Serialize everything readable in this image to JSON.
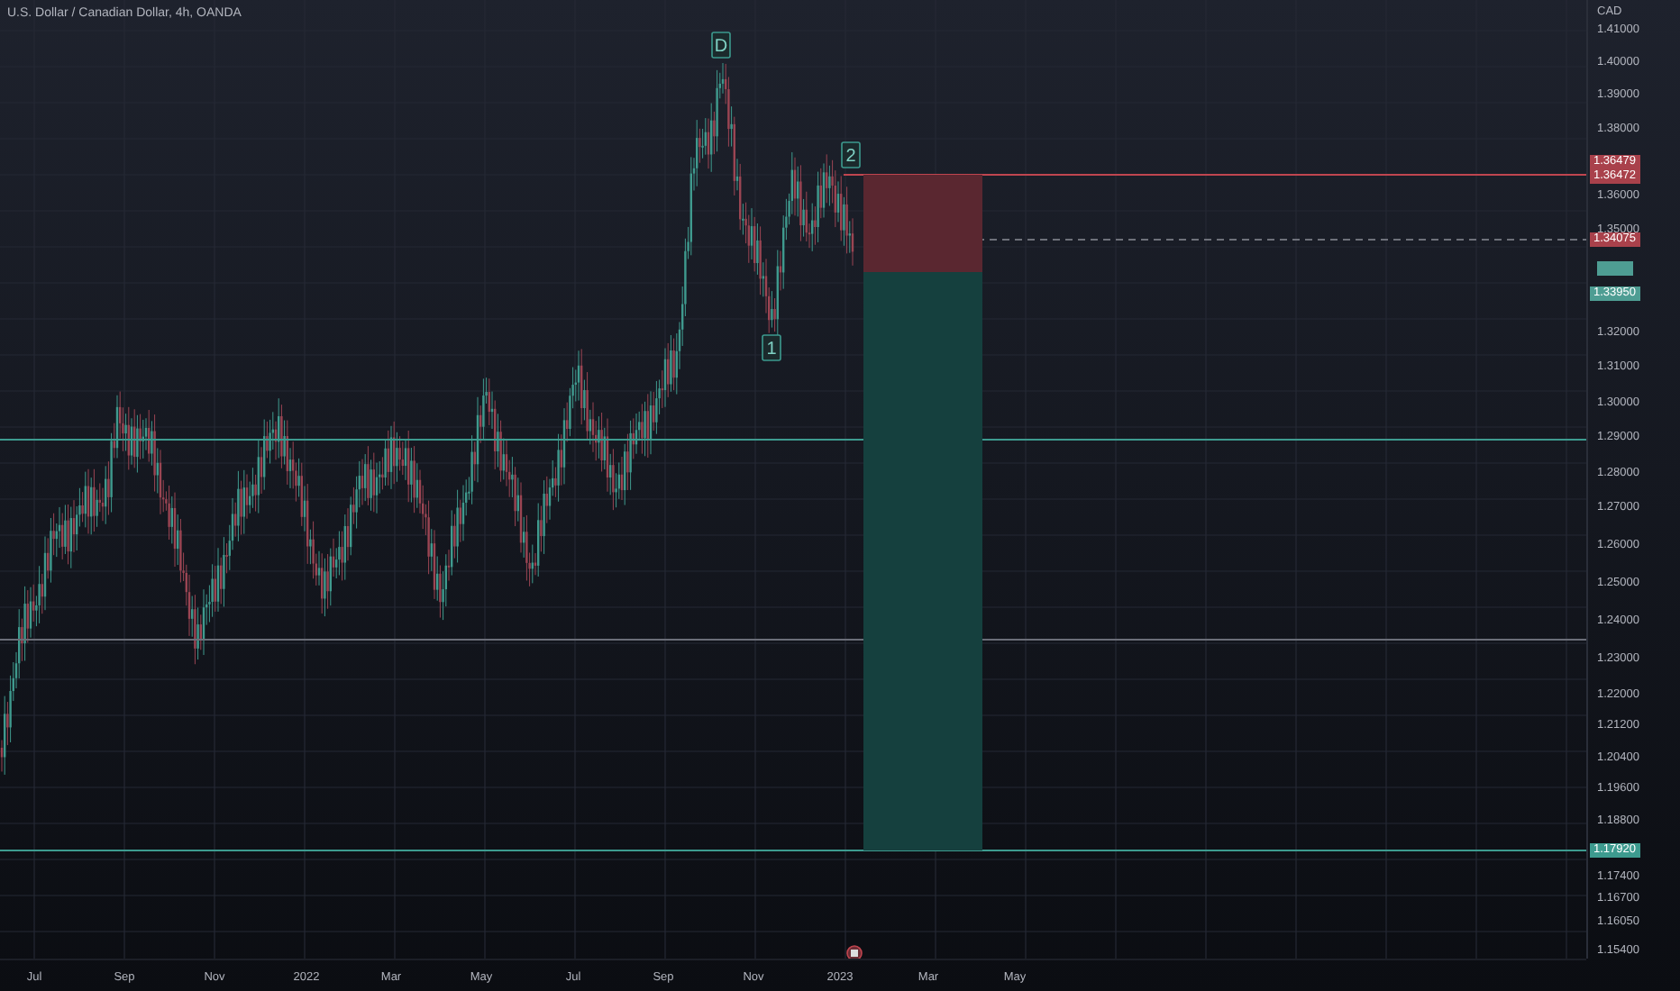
{
  "title": "U.S. Dollar / Canadian Dollar, 4h, OANDA",
  "price_axis": {
    "unit": "CAD",
    "ticks": [
      "1.41000",
      "1.40000",
      "1.39000",
      "1.38000",
      "1.36000",
      "1.35000",
      "1.32000",
      "1.31000",
      "1.30000",
      "1.29000",
      "1.28000",
      "1.27000",
      "1.26000",
      "1.25000",
      "1.24000",
      "1.23000",
      "1.22000",
      "1.21200",
      "1.20400",
      "1.19600",
      "1.18800",
      "1.17400",
      "1.16700",
      "1.16050",
      "1.15400"
    ]
  },
  "price_tags": [
    {
      "text": "1.36479",
      "kind": "stop"
    },
    {
      "text": "1.36472",
      "kind": "stop"
    },
    {
      "text": "1.34075",
      "kind": "entry"
    },
    {
      "text": "1.33950",
      "kind": "last"
    },
    {
      "text": "1.17920",
      "kind": "target"
    }
  ],
  "wave_labels": [
    "D",
    "2",
    "1"
  ],
  "time_axis": [
    "Jul",
    "Sep",
    "Nov",
    "2022",
    "Mar",
    "May",
    "Jul",
    "Sep",
    "Nov",
    "2023",
    "Mar",
    "May"
  ]
}
